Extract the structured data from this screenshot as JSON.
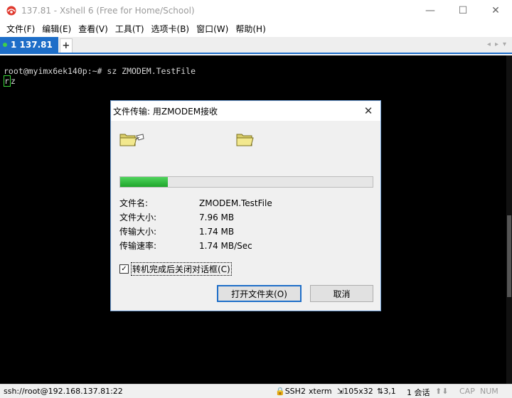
{
  "window": {
    "title": "137.81 - Xshell 6 (Free for Home/School)",
    "minimize": "—",
    "maximize": "☐",
    "close": "✕"
  },
  "menu": [
    "文件(F)",
    "编辑(E)",
    "查看(V)",
    "工具(T)",
    "选项卡(B)",
    "窗口(W)",
    "帮助(H)"
  ],
  "tabs": {
    "active_label": "1 137.81",
    "add_label": "+",
    "prev": "◂",
    "next": "▸",
    "more": "▾"
  },
  "terminal": {
    "line1": "root@myimx6ek140p:~# sz ZMODEM.TestFile",
    "line2_cursor": "r",
    "line2_rest": "z"
  },
  "dialog": {
    "title": "文件传输: 用ZMODEM接收",
    "close": "✕",
    "progress_fraction": 0.19,
    "rows": [
      {
        "label": "文件名:",
        "value": "ZMODEM.TestFile"
      },
      {
        "label": "文件大小:",
        "value": "7.96 MB"
      },
      {
        "label": "传输大小:",
        "value": "1.74 MB"
      },
      {
        "label": "传输速率:",
        "value": "1.74 MB/Sec"
      }
    ],
    "checkbox_label": "转机完成后关闭对话框(C)",
    "checkbox_mark": "✓",
    "open_folder_button": "打开文件夹(O)",
    "cancel_button": "取消"
  },
  "status": {
    "connection": "ssh://root@192.168.137.81:22",
    "protocol": "SSH2",
    "terminal_type": "xterm",
    "size": "105x32",
    "position": "3,1",
    "sessions": "1 会话",
    "caps": "CAP",
    "num": "NUM"
  },
  "colors": {
    "accent": "#1e6ec8",
    "progress": "#2bb537",
    "terminal_bg": "#000000"
  }
}
